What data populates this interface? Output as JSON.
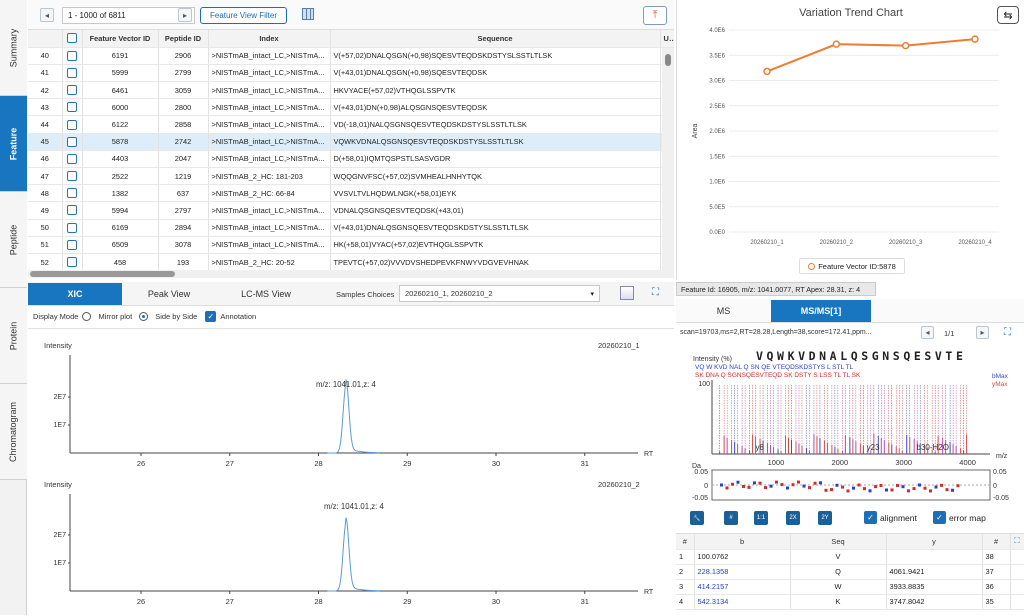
{
  "left_tabs": [
    "Summary",
    "Feature",
    "Peptide",
    "Protein",
    "Chromatogram"
  ],
  "toolbar": {
    "range": "1 - 1000 of 6811",
    "filter_label": "Feature View Filter"
  },
  "feature_table": {
    "columns": [
      "",
      "Feature Vector ID",
      "Peptide ID",
      "Index",
      "Sequence",
      "Ur"
    ],
    "rows": [
      [
        "40",
        "6191",
        "2906",
        ">NISTmAB_intact_LC,>NISTmA...",
        "V(+57,02)DNALQSGN(+0,98)SQESVTEQDSKDSTYSLSSTLTLSK"
      ],
      [
        "41",
        "5999",
        "2799",
        ">NISTmAB_intact_LC,>NISTmA...",
        "V(+43,01)DNALQSGN(+0,98)SQESVTEQDSK"
      ],
      [
        "42",
        "6461",
        "3059",
        ">NISTmAB_intact_LC,>NISTmA...",
        "HKVYACE(+57,02)VTHQGLSSPVTK"
      ],
      [
        "43",
        "6000",
        "2800",
        ">NISTmAB_intact_LC,>NISTmA...",
        "V(+43,01)DN(+0,98)ALQSGNSQESVTEQDSK"
      ],
      [
        "44",
        "6122",
        "2858",
        ">NISTmAB_intact_LC,>NISTmA...",
        "VD(-18,01)NALQSGNSQESVTEQDSKDSTYSLSSTLTLSK"
      ],
      [
        "45",
        "5878",
        "2742",
        ">NISTmAB_intact_LC,>NISTmA...",
        "VQWKVDNALQSGNSQESVTEQDSKDSTYSLSSTLTLSK"
      ],
      [
        "46",
        "4403",
        "2047",
        ">NISTmAB_intact_LC,>NISTmA...",
        "D(+58,01)IQMTQSPSTLSASVGDR"
      ],
      [
        "47",
        "2522",
        "1219",
        ">NISTmAB_2_HC: 181-203",
        "WQQGNVFSC(+57,02)SVMHEALHNHYTQK"
      ],
      [
        "48",
        "1382",
        "637",
        ">NISTmAB_2_HC: 66-84",
        "VVSVLTVLHQDWLNGK(+58,01)EYK"
      ],
      [
        "49",
        "5994",
        "2797",
        ">NISTmAB_intact_LC,>NISTmA...",
        "VDNALQSGNSQESVTEQDSK(+43,01)"
      ],
      [
        "50",
        "6169",
        "2894",
        ">NISTmAB_intact_LC,>NISTmA...",
        "V(+43,01)DNALQSGNSQESVTEQDSKDSTYSLSSTLTLSK"
      ],
      [
        "51",
        "6509",
        "3078",
        ">NISTmAB_intact_LC,>NISTmA...",
        "HK(+58,01)VYAC(+57,02)EVTHQGLSSPVTK"
      ],
      [
        "52",
        "458",
        "193",
        ">NISTmAB_2_HC: 20-52",
        "TPEVTC(+57,02)VVVDVSHEDPEVKFNWYVDGVEVHNAK"
      ]
    ],
    "selected_row": 5
  },
  "trend_chart": {
    "title": "Variation Trend Chart",
    "legend": "Feature Vector ID:5878"
  },
  "chart_data": {
    "type": "line",
    "title": "Variation Trend Chart",
    "xlabel": "",
    "ylabel": "Area",
    "categories": [
      "20260210_1",
      "20260210_2",
      "20260210_3",
      "20260210_4"
    ],
    "series": [
      {
        "name": "Feature Vector ID:5878",
        "values": [
          3180000,
          3720000,
          3690000,
          3820000
        ]
      }
    ],
    "yticks": [
      "0.0E0",
      "5.0E5",
      "1.0E6",
      "1.5E6",
      "2.0E6",
      "2.5E6",
      "3.0E6",
      "3.5E6",
      "4.0E6"
    ],
    "ylim": [
      0,
      4000000
    ],
    "grid": true,
    "legend_position": "bottom",
    "color": "#ed7d31"
  },
  "view_tabs": [
    "XIC",
    "Peak View",
    "LC-MS View"
  ],
  "samples": {
    "label": "Samples Choices",
    "value": "20260210_1, 20260210_2"
  },
  "display_mode": {
    "label": "Display Mode",
    "mirror": "Mirror plot",
    "side": "Side by Side",
    "annotation": "Annotation"
  },
  "xic": {
    "plots": [
      {
        "ylabel": "Intensity",
        "sample": "20260210_1",
        "peak_label": "m/z: 1041.01,z: 4",
        "yticks": [
          "2E7",
          "1E7"
        ]
      },
      {
        "ylabel": "Intensity",
        "sample": "20260210_2",
        "peak_label": "m/z: 1041.01,z: 4",
        "yticks": [
          "2E7",
          "1E7"
        ]
      }
    ],
    "xticks": [
      "26",
      "27",
      "28",
      "29",
      "30",
      "31"
    ],
    "xunit": "RT"
  },
  "feature_info": "Feature Id: 16905, m/z: 1041.0077, RT Apex: 28.31, z: 4",
  "ms_tabs": [
    "MS",
    "MS/MS[1]"
  ],
  "scan_info": "scan=19703,ms=2,RT=28.28,Length=38,score=172.41,ppm...",
  "page_indicator": "1/1",
  "spectrum": {
    "ylabel": "Intensity (%)",
    "sequence": "VQWKVDNALQSGNSQESVTE",
    "ytick": "100",
    "xticks": [
      "1000",
      "2000",
      "3000",
      "4000"
    ],
    "xunit": "m/z",
    "annotations": [
      "y8",
      "y23",
      "b30-H2O"
    ],
    "legend": [
      "bMax",
      "yMax"
    ],
    "b_frag_text": "VQ W KVD NAL Q SN  QE      VTEQDSKDSTYS    L STL TL",
    "y_frag_text": "SK DNA Q SGNSQESVTEQD SK DSTY S LSS TL TL SK",
    "err_label": "Da",
    "err_ticks": [
      "0.05",
      "0",
      "-0.05"
    ]
  },
  "spectrum_buttons": [
    "#",
    "1:1",
    "2X",
    "2Y"
  ],
  "spectrum_checks": [
    "alignment",
    "error map"
  ],
  "ion_table": {
    "columns": [
      "#",
      "b",
      "Seq",
      "y",
      "#"
    ],
    "rows": [
      [
        "1",
        "100.0762",
        "V",
        "",
        "38"
      ],
      [
        "2",
        "228.1358",
        "Q",
        "4061.9421",
        "37"
      ],
      [
        "3",
        "414.2157",
        "W",
        "3933.8835",
        "36"
      ],
      [
        "4",
        "542.3134",
        "K",
        "3747.8042",
        "35"
      ]
    ]
  }
}
